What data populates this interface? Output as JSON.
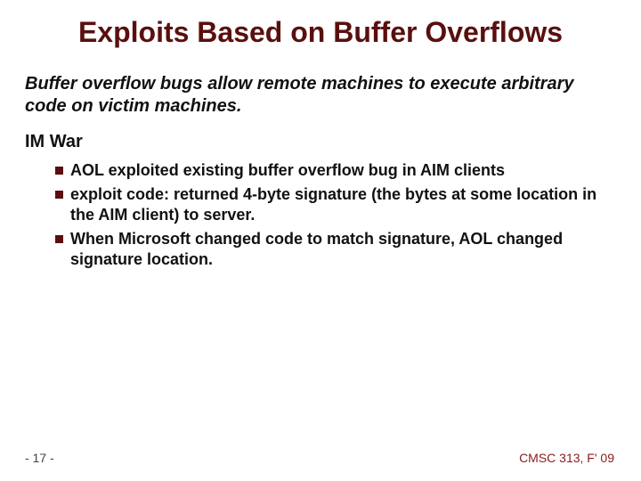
{
  "title": "Exploits Based on Buffer Overflows",
  "subtitle": "Buffer overflow bugs allow remote machines to execute arbitrary code on victim machines.",
  "section": "IM War",
  "bullets": [
    "AOL exploited existing buffer overflow bug in AIM clients",
    "exploit code: returned 4-byte signature (the bytes at some location in the AIM client) to server.",
    "When Microsoft changed code to match signature, AOL changed signature location."
  ],
  "pagenum": "- 17 -",
  "course": "CMSC 313, F' 09"
}
